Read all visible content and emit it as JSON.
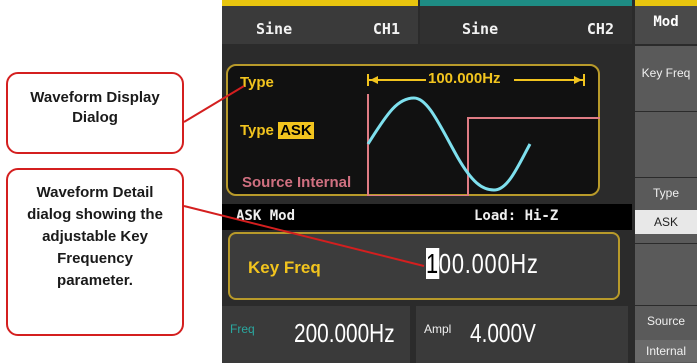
{
  "channel_tabs": [
    {
      "waveform": "Sine",
      "channel": "CH1"
    },
    {
      "waveform": "Sine",
      "channel": "CH2"
    }
  ],
  "menu": {
    "title": "Mod",
    "items": [
      {
        "label": "Key Freq",
        "value": ""
      },
      {
        "label": "",
        "value": ""
      },
      {
        "label": "Type",
        "value": "ASK"
      },
      {
        "label": "",
        "value": ""
      },
      {
        "label": "Source",
        "value": "Internal"
      }
    ]
  },
  "waveform_display": {
    "type_label": "Type",
    "frequency_marker": "100.000Hz",
    "type_prefix": "Type",
    "type_value": "ASK",
    "source_text": "Source Internal"
  },
  "detail": {
    "mode": "ASK Mod",
    "load": "Load: Hi-Z",
    "param_label": "Key Freq",
    "param_cursor_digit": "1",
    "param_rest": "00.000Hz"
  },
  "bottom": {
    "freq_label": "Freq",
    "freq_value": "200.000Hz",
    "ampl_label": "Ampl",
    "ampl_value": "4.000V"
  },
  "callouts": {
    "waveform_display": "Waveform Display Dialog",
    "waveform_detail": "Waveform Detail dialog showing the adjustable Key Frequency parameter."
  },
  "colors": {
    "ch1_accent": "#e8c50e",
    "ch2_accent": "#1e8c84",
    "highlight": "#f2c41e",
    "carrier_wave": "#7ee0ee",
    "envelope": "#e07c84",
    "callout_border": "#d41f1f"
  }
}
